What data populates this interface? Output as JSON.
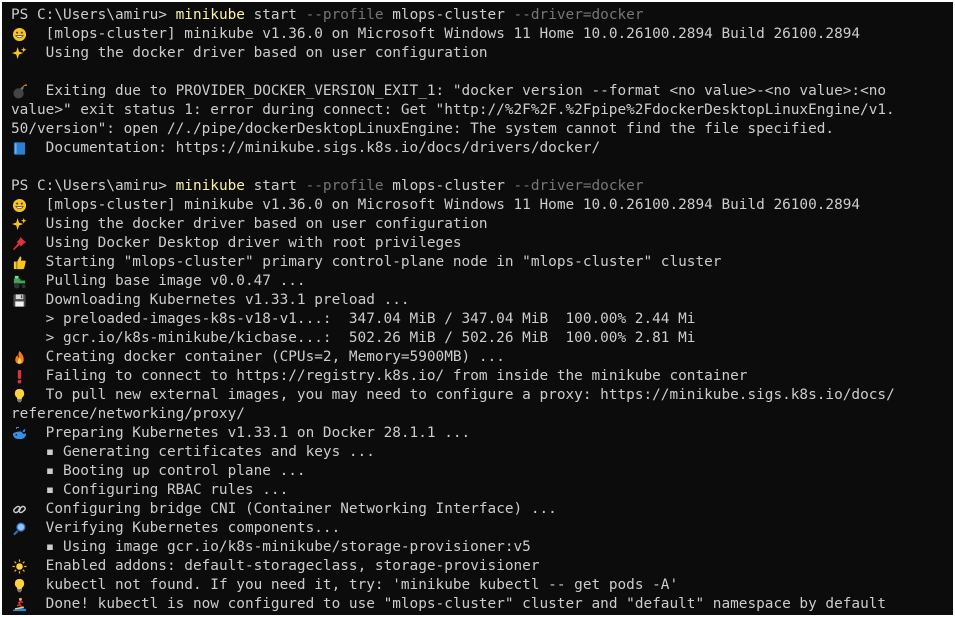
{
  "colors": {
    "background": "#0c0c0c",
    "foreground": "#cccccc",
    "command": "#f9f1a5",
    "flag": "#767676"
  },
  "blocks": [
    {
      "prompt": "PS C:\\Users\\amiru> ",
      "command": {
        "exe": "minikube",
        "sub": " start ",
        "flag1": "--profile",
        "arg1": " mlops-cluster ",
        "flag2": "--driver=docker"
      },
      "lines": [
        {
          "icon": "grinning-face-icon",
          "text": "[mlops-cluster] minikube v1.36.0 on Microsoft Windows 11 Home 10.0.26100.2894 Build 26100.2894"
        },
        {
          "icon": "sparkles-icon",
          "text": "Using the docker driver based on user configuration"
        },
        {
          "blank": true
        },
        {
          "icon": "bomb-icon",
          "text": "Exiting due to PROVIDER_DOCKER_VERSION_EXIT_1: \"docker version --format <no value>-<no value>:<no"
        },
        {
          "text": "value>\" exit status 1: error during connect: Get \"http://%2F%2F.%2Fpipe%2FdockerDesktopLinuxEngine/v1."
        },
        {
          "text": "50/version\": open //./pipe/dockerDesktopLinuxEngine: The system cannot find the file specified."
        },
        {
          "icon": "blue-book-icon",
          "text": "Documentation: https://minikube.sigs.k8s.io/docs/drivers/docker/"
        },
        {
          "blank": true
        }
      ]
    },
    {
      "prompt": "PS C:\\Users\\amiru> ",
      "command": {
        "exe": "minikube",
        "sub": " start ",
        "flag1": "--profile",
        "arg1": " mlops-cluster ",
        "flag2": "--driver=docker"
      },
      "lines": [
        {
          "icon": "grinning-face-icon",
          "text": "[mlops-cluster] minikube v1.36.0 on Microsoft Windows 11 Home 10.0.26100.2894 Build 26100.2894"
        },
        {
          "icon": "sparkles-icon",
          "text": "Using the docker driver based on user configuration"
        },
        {
          "icon": "pushpin-icon",
          "text": "Using Docker Desktop driver with root privileges"
        },
        {
          "icon": "thumbs-up-icon",
          "text": "Starting \"mlops-cluster\" primary control-plane node in \"mlops-cluster\" cluster"
        },
        {
          "icon": "tractor-icon",
          "text": "Pulling base image v0.0.47 ..."
        },
        {
          "icon": "floppy-disk-icon",
          "text": "Downloading Kubernetes v1.33.1 preload ..."
        },
        {
          "indent": "    ",
          "text": "> preloaded-images-k8s-v18-v1...:  347.04 MiB / 347.04 MiB  100.00% 2.44 Mi"
        },
        {
          "indent": "    ",
          "text": "> gcr.io/k8s-minikube/kicbase...:  502.26 MiB / 502.26 MiB  100.00% 2.81 Mi"
        },
        {
          "icon": "fire-icon",
          "text": "Creating docker container (CPUs=2, Memory=5900MB) ..."
        },
        {
          "icon": "exclamation-icon",
          "text": "Failing to connect to https://registry.k8s.io/ from inside the minikube container"
        },
        {
          "icon": "lightbulb-icon",
          "text": "To pull new external images, you may need to configure a proxy: https://minikube.sigs.k8s.io/docs/"
        },
        {
          "text": "reference/networking/proxy/"
        },
        {
          "icon": "whale-icon",
          "text": "Preparing Kubernetes v1.33.1 on Docker 28.1.1 ..."
        },
        {
          "indent": "    ",
          "text": "▪ Generating certificates and keys ..."
        },
        {
          "indent": "    ",
          "text": "▪ Booting up control plane ..."
        },
        {
          "indent": "    ",
          "text": "▪ Configuring RBAC rules ..."
        },
        {
          "icon": "link-icon",
          "text": "Configuring bridge CNI (Container Networking Interface) ..."
        },
        {
          "icon": "magnifier-icon",
          "text": "Verifying Kubernetes components..."
        },
        {
          "indent": "    ",
          "text": "▪ Using image gcr.io/k8s-minikube/storage-provisioner:v5"
        },
        {
          "icon": "star-icon",
          "text": "Enabled addons: default-storageclass, storage-provisioner"
        },
        {
          "icon": "lightbulb-icon",
          "text": "kubectl not found. If you need it, try: 'minikube kubectl -- get pods -A'"
        },
        {
          "icon": "surfer-icon",
          "text": "Done! kubectl is now configured to use \"mlops-cluster\" cluster and \"default\" namespace by default"
        }
      ]
    }
  ]
}
